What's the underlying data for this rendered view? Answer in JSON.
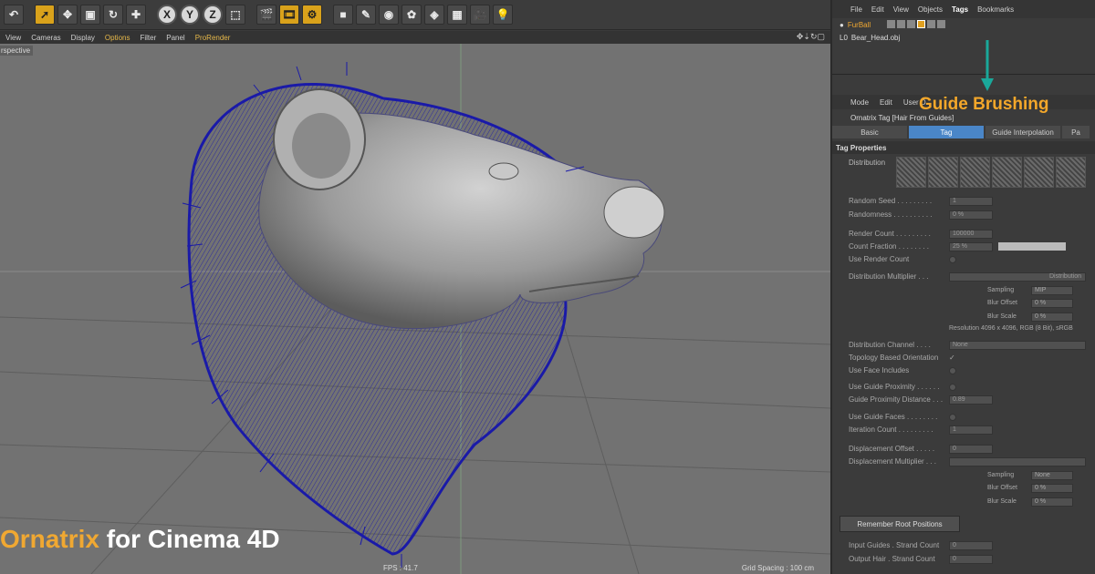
{
  "toolbar": {
    "axis_x": "X",
    "axis_y": "Y",
    "axis_z": "Z"
  },
  "viewport_menu": [
    "View",
    "Cameras",
    "Display",
    "Options",
    "Filter",
    "Panel",
    "ProRender"
  ],
  "viewport_menu_active": "Options",
  "viewport": {
    "perspective_label": "rspective",
    "fps": "FPS : 41.7",
    "grid_spacing": "Grid Spacing : 100 cm",
    "brand_word1": "Ornatrix",
    "brand_word2": " for Cinema 4D",
    "hair_color": "#1a1aa8",
    "bg_color": "#727272"
  },
  "object_manager": {
    "menu": [
      "File",
      "Edit",
      "View",
      "Objects",
      "Tags",
      "Bookmarks"
    ],
    "active_menu": "Tags",
    "objects": [
      {
        "name": "FurBall"
      },
      {
        "name": "Bear_Head.obj"
      }
    ]
  },
  "callout": {
    "text": "Guide Brushing",
    "color": "#f3a72a",
    "arrow_color": "#1aa89a"
  },
  "attributes": {
    "menu": [
      "Mode",
      "Edit",
      "User D"
    ],
    "title": "Ornatrix Tag [Hair From Guides]",
    "tabs": [
      "Basic",
      "Tag",
      "Guide Interpolation",
      "Pa"
    ],
    "active_tab": "Tag",
    "section": "Tag Properties",
    "distribution_label": "Distribution",
    "props": [
      {
        "label": "Random Seed . . . . . . . . .",
        "value": "1"
      },
      {
        "label": "Randomness . . . . . . . . . .",
        "value": "0 %"
      },
      {
        "label": "Render Count . . . . . . . . .",
        "value": "100000"
      },
      {
        "label": "Count Fraction . . . . . . . .",
        "value": "25 %"
      },
      {
        "label": "Use Render Count",
        "value": ""
      },
      {
        "label": "Distribution Multiplier . . .",
        "value": "Distribution"
      },
      {
        "label": "Distribution Channel . . . .",
        "value": "None"
      },
      {
        "label": "Topology Based Orientation",
        "value": "✓"
      },
      {
        "label": "Use Face Includes",
        "value": ""
      },
      {
        "label": "Use Guide Proximity . . . . . .",
        "value": ""
      },
      {
        "label": "Guide Proximity Distance . . .",
        "value": "0.89"
      },
      {
        "label": "Use Guide Faces . . . . . . . .",
        "value": ""
      },
      {
        "label": "Iteration Count . . . . . . . . .",
        "value": "1"
      },
      {
        "label": "Displacement Offset . . . . .",
        "value": "0"
      },
      {
        "label": "Displacement Multiplier . . .",
        "value": ""
      }
    ],
    "sub1": [
      {
        "label": "Sampling",
        "value": "MIP"
      },
      {
        "label": "Blur Offset",
        "value": "0 %"
      },
      {
        "label": "Blur Scale",
        "value": "0 %"
      }
    ],
    "resolution": "Resolution 4096 x 4096, RGB (8 Bit), sRGB",
    "sub2": [
      {
        "label": "Sampling",
        "value": "None"
      },
      {
        "label": "Blur Offset",
        "value": "0 %"
      },
      {
        "label": "Blur Scale",
        "value": "0 %"
      }
    ],
    "remember_button": "Remember Root Positions",
    "counts": [
      {
        "label": "Input Guides . Strand Count",
        "value": "0"
      },
      {
        "label": "Output Hair . Strand Count",
        "value": "0"
      }
    ]
  }
}
